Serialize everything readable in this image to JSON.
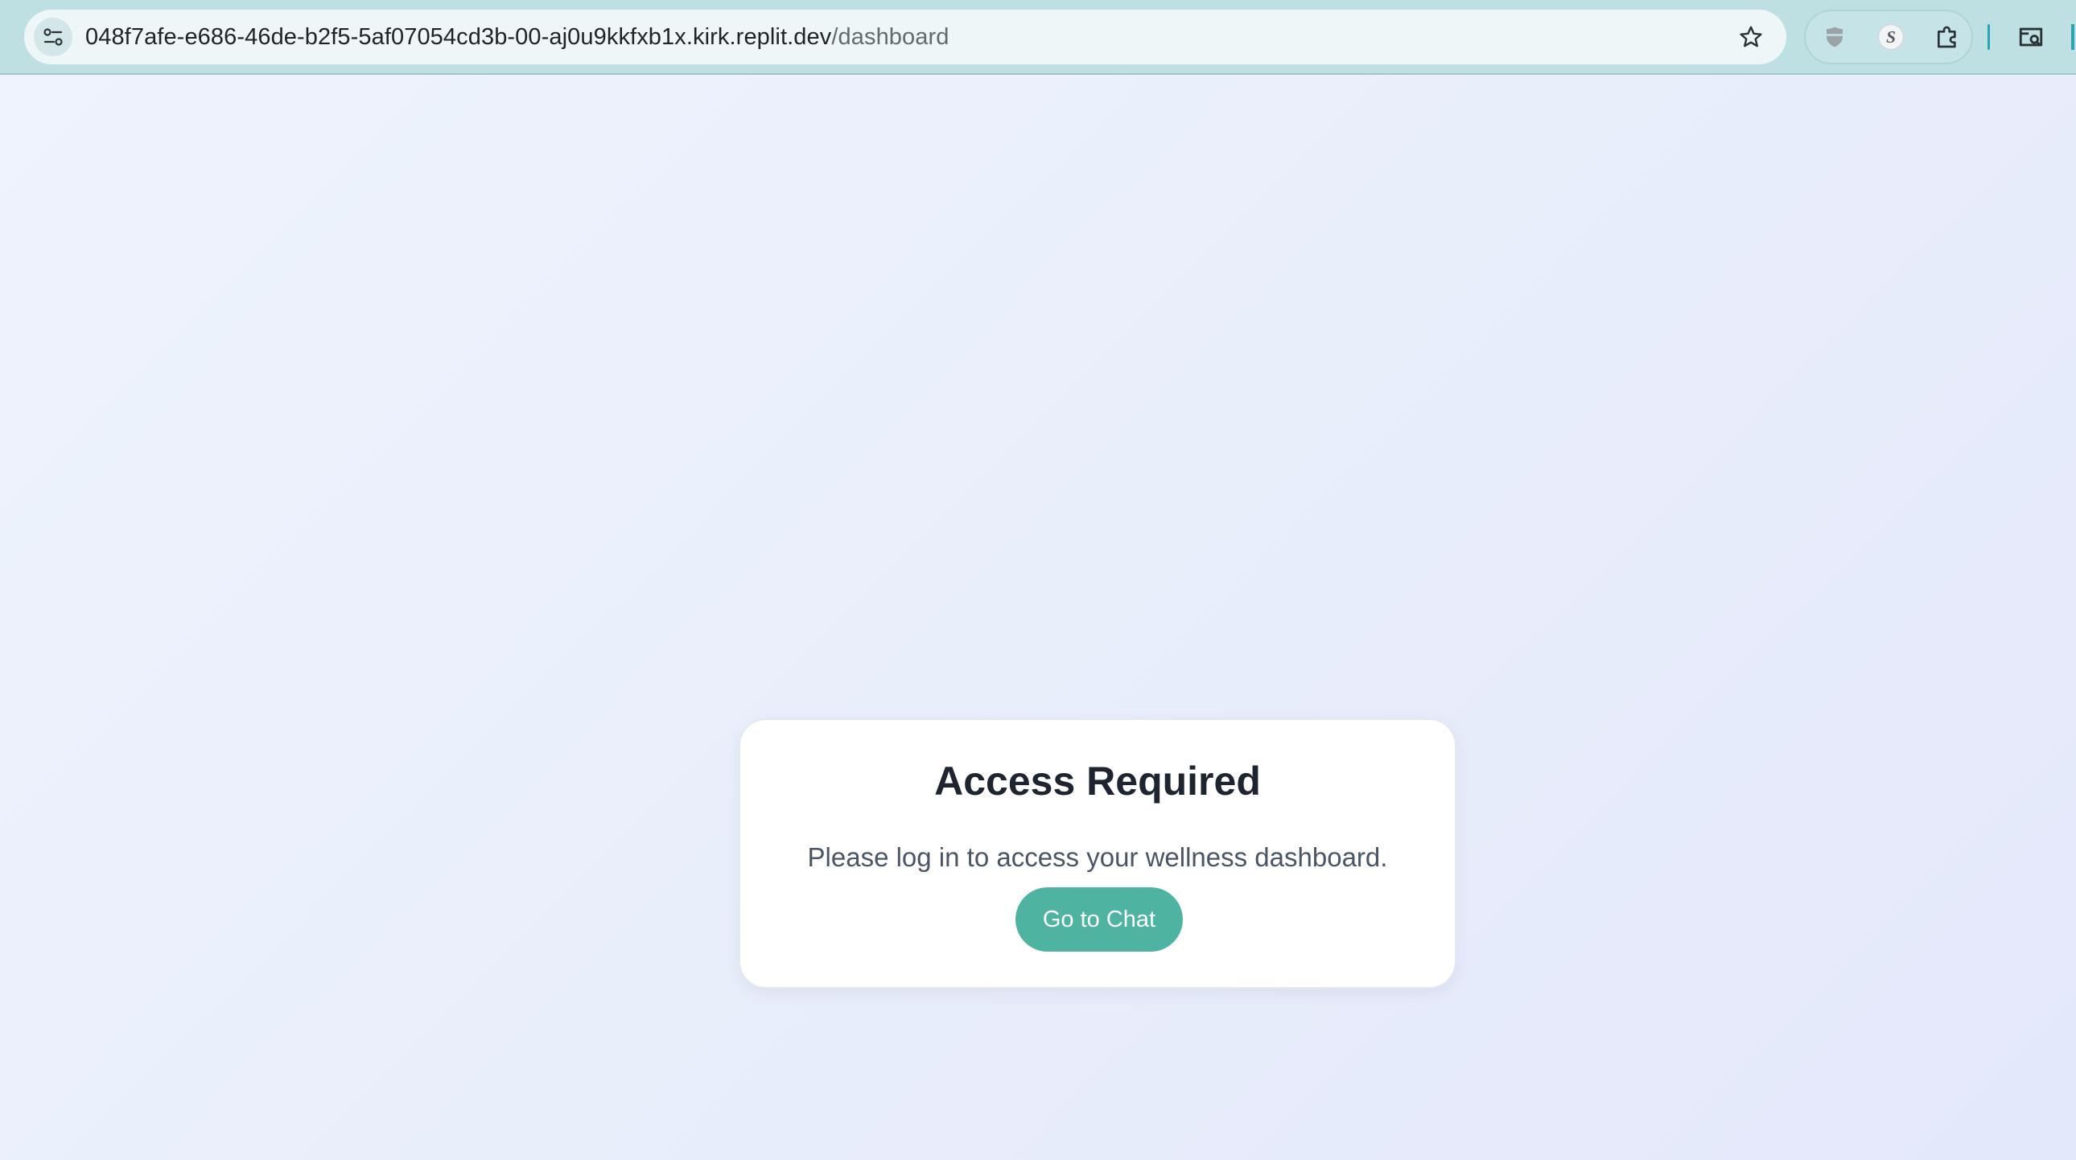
{
  "browser": {
    "url_host": "048f7afe-e686-46de-b2f5-5af07054cd3b-00-aj0u9kkfxb1x.kirk.replit.dev",
    "url_path": "/dashboard",
    "icons": {
      "site_info": "site-settings-icon",
      "bookmark": "star-icon",
      "extensions": [
        "shield-extension-icon",
        "s-extension-icon",
        "puzzle-extensions-icon"
      ],
      "search_tab": "search-tabs-icon"
    },
    "accent_color": "#2aa3b5",
    "toolbar_color": "#bfe0e3"
  },
  "card": {
    "title": "Access Required",
    "message": "Please log in to access your wellness dashboard.",
    "button_label": "Go to Chat",
    "button_color": "#4fb3a1"
  }
}
